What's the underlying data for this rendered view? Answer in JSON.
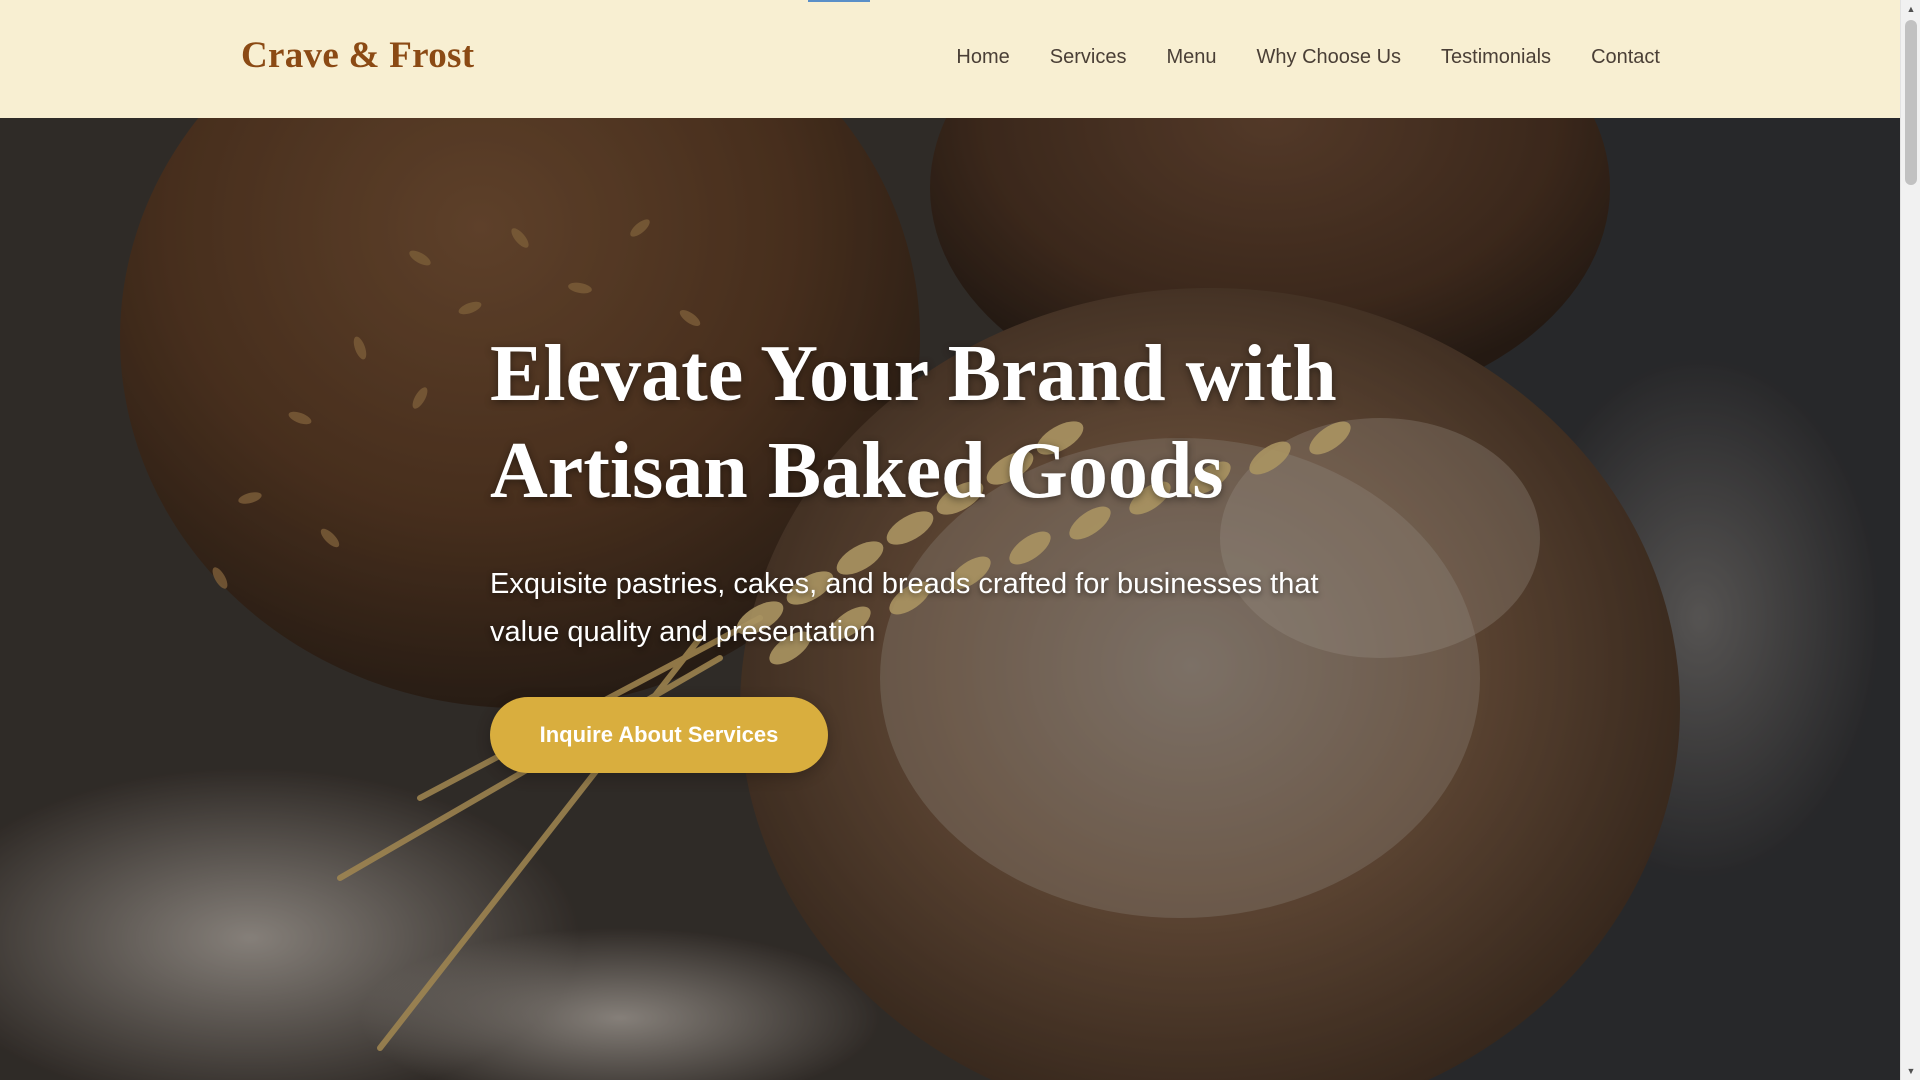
{
  "header": {
    "brand": "Crave & Frost",
    "nav": [
      {
        "label": "Home"
      },
      {
        "label": "Services"
      },
      {
        "label": "Menu"
      },
      {
        "label": "Why Choose Us"
      },
      {
        "label": "Testimonials"
      },
      {
        "label": "Contact"
      }
    ]
  },
  "hero": {
    "title_line1": "Elevate Your Brand with",
    "title_line2": "Artisan Baked Goods",
    "subtitle": "Exquisite pastries, cakes, and breads crafted for businesses that value quality and presentation",
    "cta_label": "Inquire About Services",
    "background_image": "artisan-bread-loaves-with-wheat"
  },
  "colors": {
    "header_bg": "#f8efd2",
    "brand": "#8b4a14",
    "nav_text": "#4a3f36",
    "cta_bg": "#d9ae3e",
    "hero_text": "#ffffff"
  },
  "icons": {
    "scroll_up": "chevron-up-icon",
    "scroll_down": "chevron-down-icon"
  }
}
